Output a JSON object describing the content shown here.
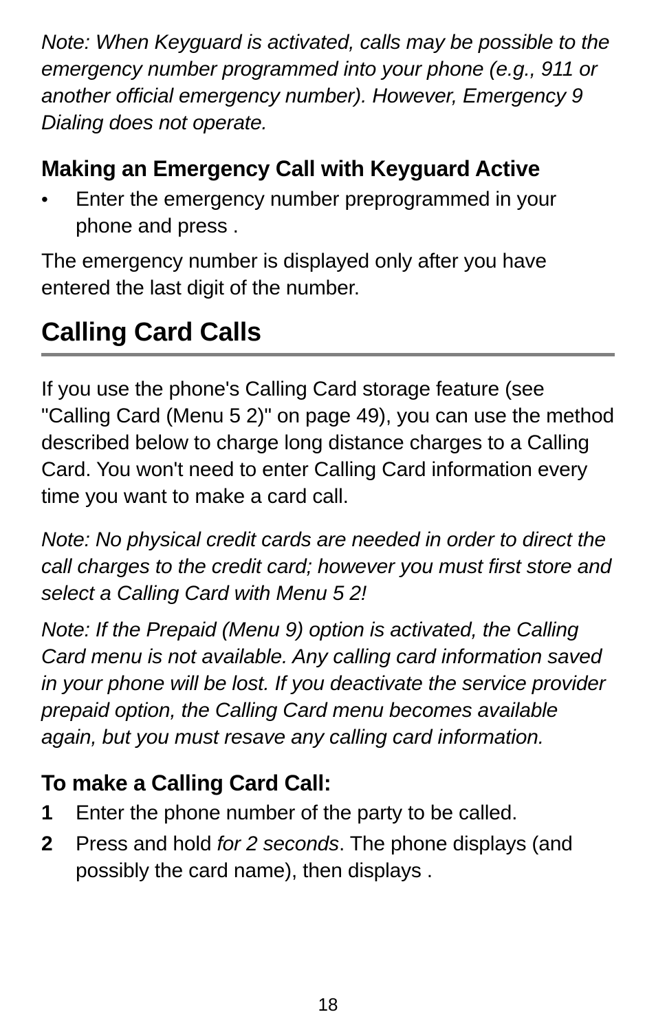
{
  "page_number": "18",
  "note_top": "Note: When Keyguard is activated, calls may be possible to the emergency number programmed into your phone (e.g., 911 or another official emergency number). However, Emergency 9 Dialing does not operate.",
  "section_emergency": {
    "heading": "Making an Emergency Call with Keyguard Active",
    "bullet": "Enter the emergency number preprogrammed in your phone and press            .",
    "after": "The emergency number is displayed only after you have entered the last digit of the number."
  },
  "section_calling": {
    "heading": "Calling Card Calls",
    "intro": "If you use the phone's Calling Card storage feature (see \"Calling Card (Menu 5 2)\" on page 49), you can use the method described below to charge long distance charges to a Calling Card. You won't need to enter Calling Card information every time you want to make a card call.",
    "note1": "Note: No physical credit cards are needed in order to direct the call charges to the credit card; however you must first store and select a Calling Card with Menu 5 2!",
    "note2": "Note: If the Prepaid (Menu 9) option is activated, the Calling Card menu is not available. Any calling card information saved in your phone will be lost. If you deactivate the service provider prepaid option, the Calling Card menu becomes available again, but you must resave any calling card information."
  },
  "section_make": {
    "heading": "To make a Calling Card Call:",
    "step1_num": "1",
    "step1_text": "Enter the phone number of the party to be called.",
    "step2_num": "2",
    "step2_a": "Press and hold            ",
    "step2_b": "for 2 seconds",
    "step2_c": ". The phone displays                      (and possibly the card name), then displays                                                                  ."
  }
}
